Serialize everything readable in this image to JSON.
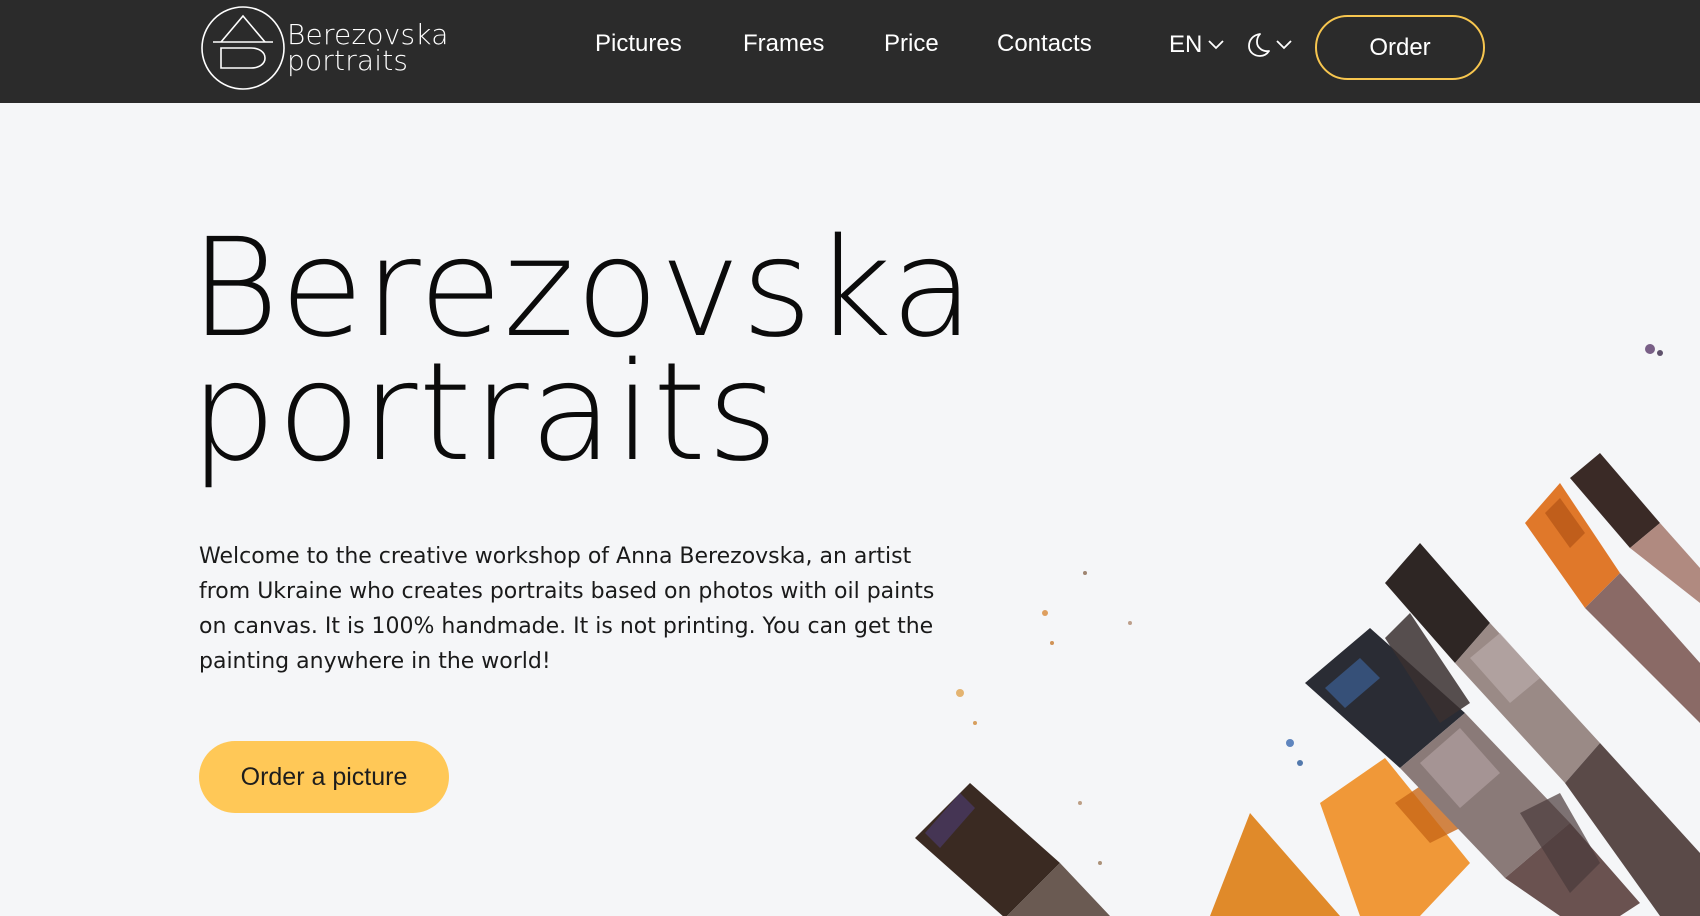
{
  "header": {
    "logo": {
      "line1": "Berezovska",
      "line2": "portraits",
      "icon": "logo-mark-icon"
    },
    "nav": [
      {
        "label": "Pictures"
      },
      {
        "label": "Frames"
      },
      {
        "label": "Price"
      },
      {
        "label": "Contacts"
      }
    ],
    "language": {
      "selected": "EN",
      "icon": "chevron-down-icon"
    },
    "theme": {
      "icon": "moon-icon"
    },
    "order_label": "Order"
  },
  "hero": {
    "title_line1": "Berezovska",
    "title_line2": "portraits",
    "description": "Welcome to the creative workshop of Anna Berezovska, an artist from Ukraine who creates portraits based on photos with oil paints on canvas. It is 100% handmade. It is not printing. You can get the painting anywhere in the world!",
    "cta_label": "Order a picture",
    "background_image": "paint-brushes-image"
  },
  "colors": {
    "header_bg": "#2b2b2b",
    "accent": "#ffc857",
    "order_border": "#f7c64f",
    "page_bg": "#f5f6f8",
    "text": "#0b0b0b"
  }
}
